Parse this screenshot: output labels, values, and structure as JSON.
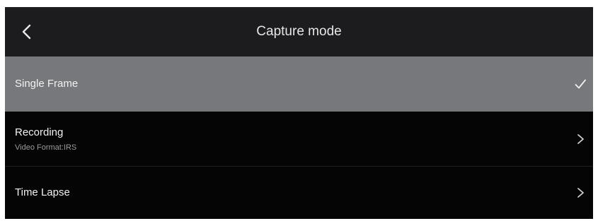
{
  "header": {
    "title": "Capture mode",
    "back_icon": "chevron-left-icon"
  },
  "colors": {
    "header_bg": "#1c1c1f",
    "list_bg": "#050505",
    "selected_bg": "#76787b",
    "text": "#f2f2f2",
    "subtext": "#9c9c9c"
  },
  "modes": [
    {
      "label": "Single Frame",
      "selected": true,
      "trailing_icon": "checkmark-icon"
    },
    {
      "label": "Recording",
      "subtitle": "Video Format:IRS",
      "selected": false,
      "trailing_icon": "chevron-right-icon"
    },
    {
      "label": "Time Lapse",
      "selected": false,
      "trailing_icon": "chevron-right-icon"
    }
  ]
}
